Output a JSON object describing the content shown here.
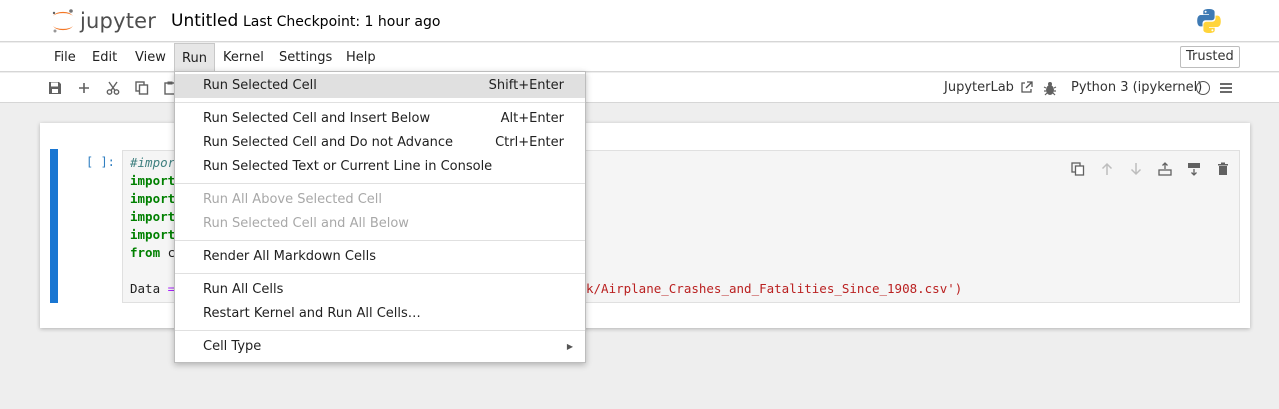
{
  "header": {
    "logo_text": "jupyter",
    "notebook_title": "Untitled",
    "checkpoint": "Last Checkpoint: 1 hour ago"
  },
  "menubar": {
    "items": [
      "File",
      "Edit",
      "View",
      "Run",
      "Kernel",
      "Settings",
      "Help"
    ],
    "active": "Run",
    "trusted": "Trusted"
  },
  "toolbar": {
    "icons": [
      "save-icon",
      "add-cell-icon",
      "cut-icon",
      "copy-icon",
      "paste-icon"
    ],
    "jupyterlab_label": "JupyterLab",
    "kernel_name": "Python 3 (ipykernel)"
  },
  "cell": {
    "prompt": "[ ]:",
    "lines": [
      {
        "parts": [
          {
            "t": "#impor",
            "c": "comment"
          }
        ]
      },
      {
        "parts": [
          {
            "t": "import",
            "c": "kw"
          }
        ]
      },
      {
        "parts": [
          {
            "t": "import",
            "c": "kw"
          }
        ]
      },
      {
        "parts": [
          {
            "t": "import",
            "c": "kw"
          }
        ]
      },
      {
        "parts": [
          {
            "t": "import",
            "c": "kw"
          }
        ]
      },
      {
        "parts": [
          {
            "t": "from",
            "c": "kw"
          },
          {
            "t": " c",
            "c": "plain"
          }
        ]
      },
      {
        "parts": [
          {
            "t": "",
            "c": "plain"
          }
        ]
      },
      {
        "parts": [
          {
            "t": "Data ",
            "c": "plain"
          },
          {
            "t": "=",
            "c": "op"
          }
        ]
      }
    ],
    "visible_string_tail": "k/Airplane_Crashes_and_Fatalities_Since_1908.csv')"
  },
  "run_menu": {
    "items": [
      {
        "label": "Run Selected Cell",
        "shortcut": "Shift+Enter",
        "highlighted": true,
        "disabled": false
      },
      {
        "label": "Run Selected Cell and Insert Below",
        "shortcut": "Alt+Enter",
        "disabled": false
      },
      {
        "label": "Run Selected Cell and Do not Advance",
        "shortcut": "Ctrl+Enter",
        "disabled": false
      },
      {
        "label": "Run Selected Text or Current Line in Console",
        "shortcut": "",
        "disabled": false
      },
      {
        "label": "Run All Above Selected Cell",
        "shortcut": "",
        "disabled": true
      },
      {
        "label": "Run Selected Cell and All Below",
        "shortcut": "",
        "disabled": true
      },
      {
        "label": "Render All Markdown Cells",
        "shortcut": "",
        "disabled": false
      },
      {
        "label": "Run All Cells",
        "shortcut": "",
        "disabled": false
      },
      {
        "label": "Restart Kernel and Run All Cells…",
        "shortcut": "",
        "disabled": false
      },
      {
        "label": "Cell Type",
        "shortcut": "",
        "disabled": false,
        "submenu": true
      }
    ]
  },
  "colors": {
    "accent": "#1976d2",
    "menu_highlight": "#e0e0e0",
    "jupyter_orange": "#f37726"
  }
}
